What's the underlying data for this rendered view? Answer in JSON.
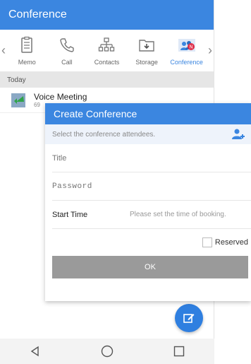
{
  "appbar": {
    "title": "Conference"
  },
  "toolbar": {
    "items": [
      {
        "label": "Memo",
        "icon": "memo-icon"
      },
      {
        "label": "Call",
        "icon": "phone-icon"
      },
      {
        "label": "Contacts",
        "icon": "org-chart-icon"
      },
      {
        "label": "Storage",
        "icon": "folder-download-icon"
      },
      {
        "label": "Conference",
        "icon": "conference-icon"
      }
    ],
    "active_index": 4,
    "badge": "N"
  },
  "list": {
    "section": "Today",
    "items": [
      {
        "title": "Voice Meeting",
        "sub": "69"
      }
    ]
  },
  "dialog": {
    "title": "Create Conference",
    "hint": "Select the conference attendees.",
    "title_placeholder": "Title",
    "password_placeholder": "Password",
    "start_label": "Start Time",
    "start_hint": "Please set the time of booking.",
    "reserved_label": "Reserved",
    "ok_label": "OK"
  },
  "colors": {
    "accent": "#3b86e0",
    "fab": "#2f7fe0",
    "ok_button": "#9a9a9a"
  }
}
